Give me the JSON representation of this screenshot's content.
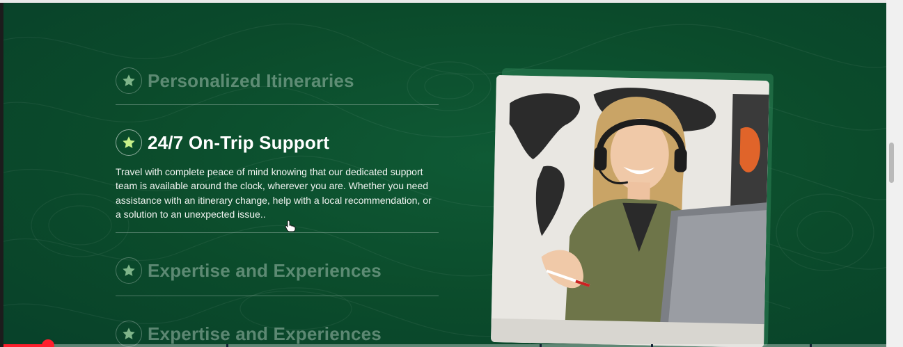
{
  "features": {
    "items": [
      {
        "title": "Personalized Itineraries",
        "icon": "star-icon",
        "state": "collapsed"
      },
      {
        "title": "24/7 On-Trip Support",
        "icon": "star-icon",
        "state": "expanded",
        "body": "Travel with complete peace of mind knowing that our dedicated support team is available around the clock, wherever you are. Whether you need assistance with an itinerary change, help with a local recommendation, or a solution to an unexpected issue.."
      },
      {
        "title": "Expertise and Experiences",
        "icon": "star-icon",
        "state": "collapsed"
      },
      {
        "title": "Expertise and Experiences",
        "icon": "star-icon",
        "state": "collapsed"
      }
    ]
  },
  "video_player": {
    "progress": 0.05
  },
  "colors": {
    "background": "#0b4b2b",
    "star_active": "#c7f08a",
    "star_dim": "#7fb58a",
    "progress": "#ff1f2d"
  }
}
